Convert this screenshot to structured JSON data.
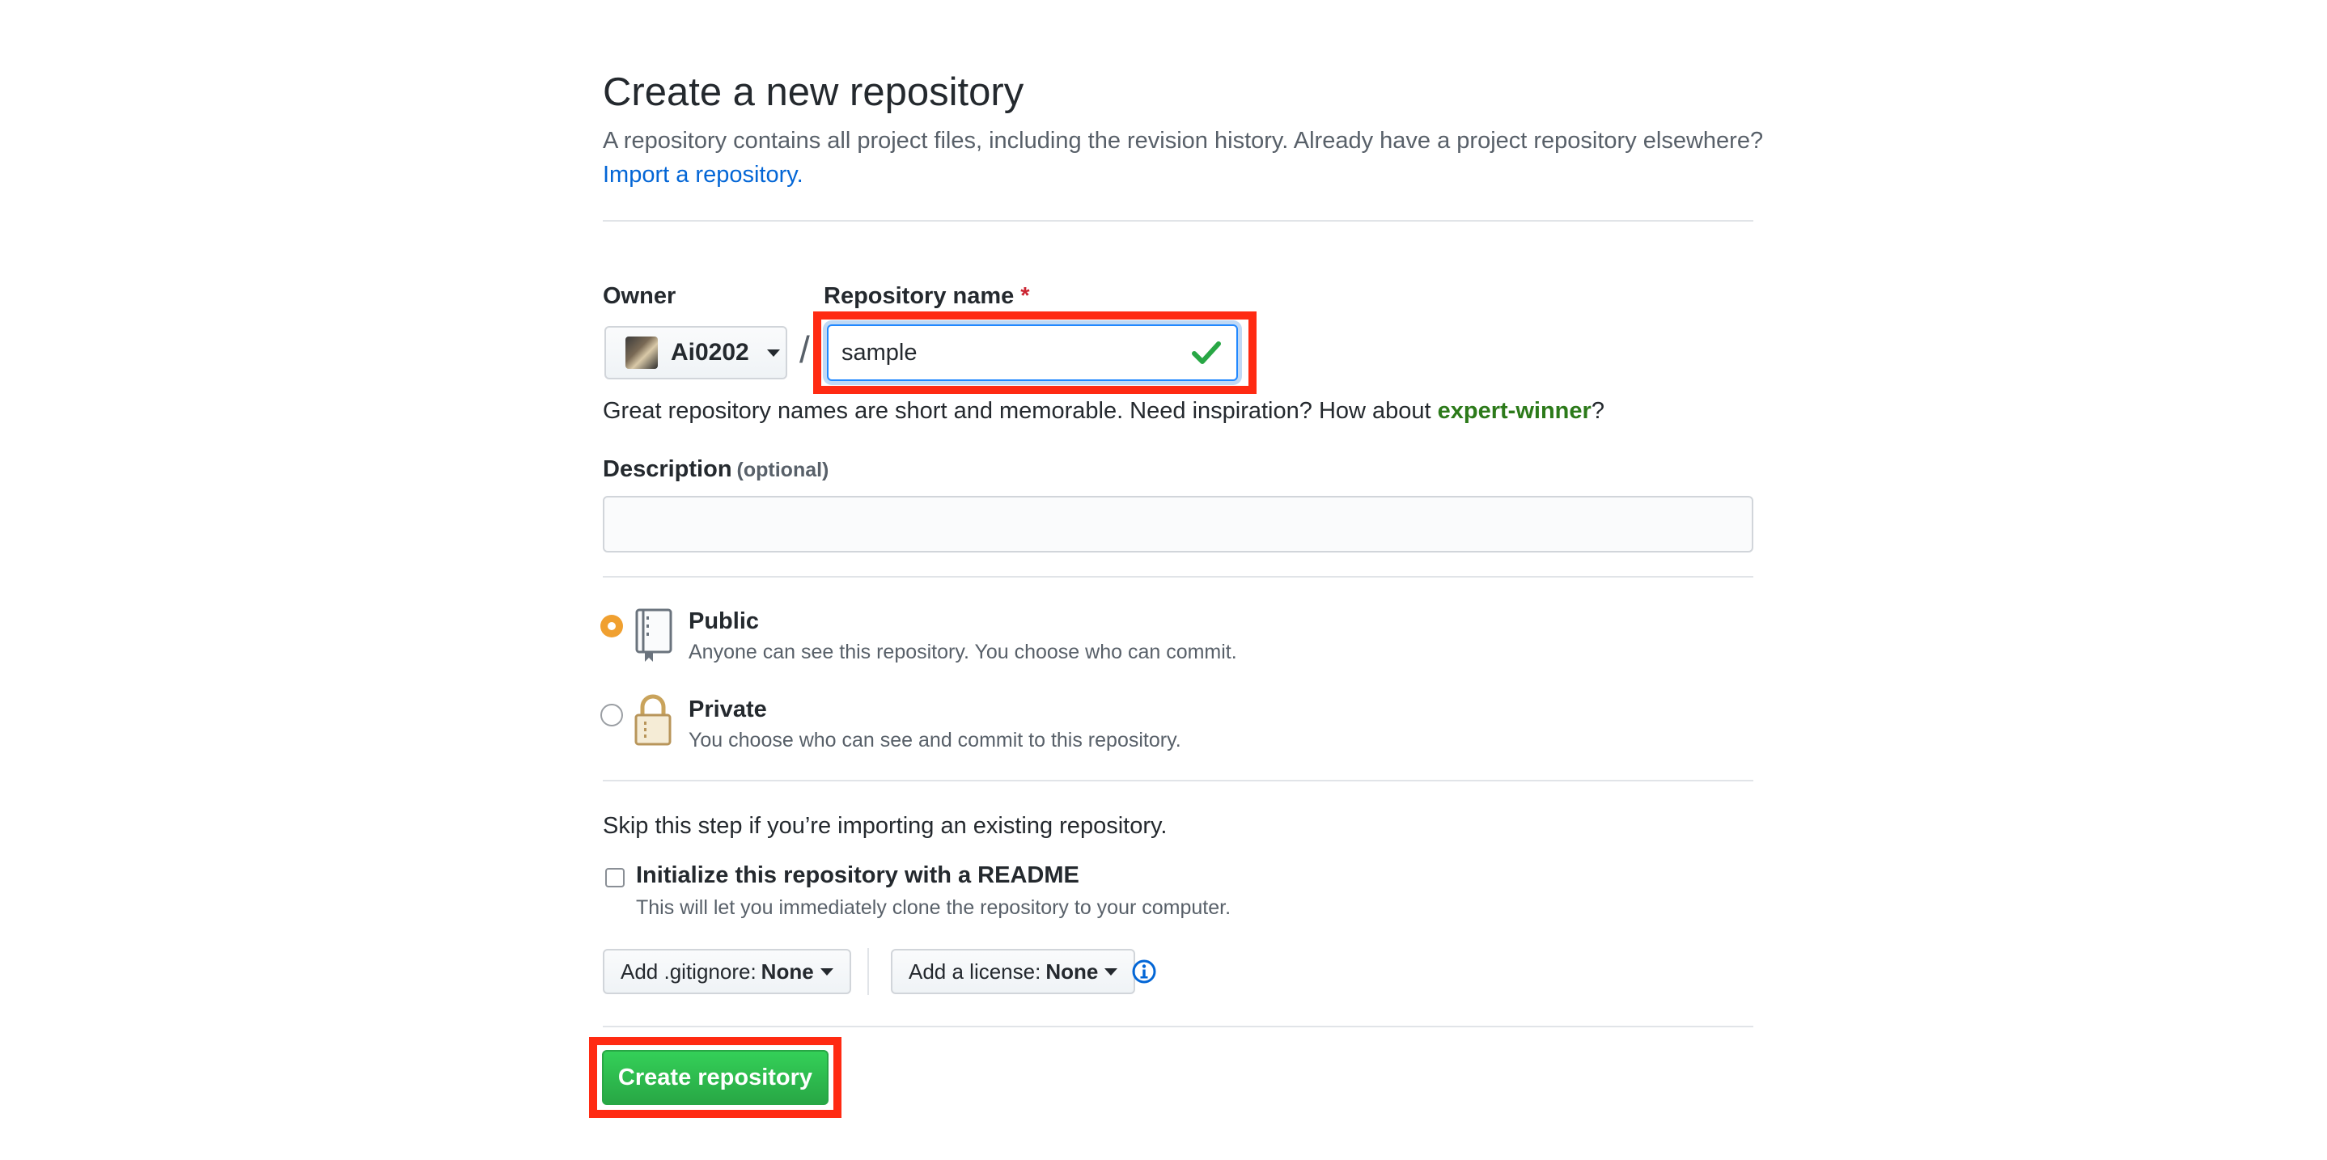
{
  "header": {
    "title": "Create a new repository",
    "subtitle": "A repository contains all project files, including the revision history. Already have a project repository elsewhere?",
    "import_link": "Import a repository."
  },
  "owner": {
    "label": "Owner",
    "name": "Ai0202"
  },
  "repo_name": {
    "label": "Repository name",
    "required_mark": "*",
    "value": "sample",
    "hint_prefix": "Great repository names are short and memorable. Need inspiration? How about ",
    "suggestion": "expert-winner",
    "hint_suffix": "?"
  },
  "separator": "/",
  "description": {
    "label": "Description",
    "optional": "(optional)",
    "value": "",
    "placeholder": ""
  },
  "visibility": {
    "selected": "public",
    "public": {
      "title": "Public",
      "desc": "Anyone can see this repository. You choose who can commit."
    },
    "private": {
      "title": "Private",
      "desc": "You choose who can see and commit to this repository."
    }
  },
  "init": {
    "skip_text": "Skip this step if you’re importing an existing repository.",
    "readme_label": "Initialize this repository with a README",
    "readme_desc": "This will let you immediately clone the repository to your computer.",
    "readme_checked": false
  },
  "gitignore": {
    "label": "Add .gitignore:",
    "value": "None"
  },
  "license": {
    "label": "Add a license:",
    "value": "None"
  },
  "submit": {
    "label": "Create repository"
  },
  "colors": {
    "link": "#0366d6",
    "success_green": "#28a745",
    "highlight_red": "#ff2a12",
    "radio_checked": "#f0a030"
  }
}
